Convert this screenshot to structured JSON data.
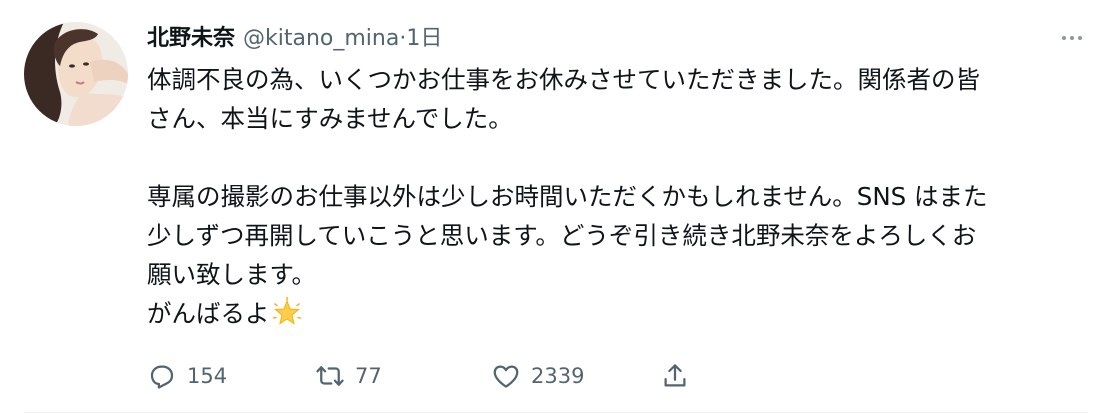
{
  "tweet": {
    "author": {
      "display_name": "北野未奈",
      "handle": "@kitano_mina",
      "separator": "·",
      "timestamp": "1日"
    },
    "body_lines": [
      "体調不良の為、いくつかお仕事をお休みさせていただきました。関係者の皆",
      "さん、本当にすみませんでした。",
      "",
      "専属の撮影のお仕事以外は少しお時間いただくかもしれません。SNS はまた",
      "少しずつ再開していこうと思います。どうぞ引き続き北野未奈をよろしくお",
      "願い致します。",
      "がんばるよ"
    ],
    "emoji": "glowing-star",
    "actions": {
      "replies": "154",
      "retweets": "77",
      "likes": "2339"
    },
    "icons": {
      "reply": "reply-icon",
      "retweet": "retweet-icon",
      "like": "heart-icon",
      "share": "share-icon",
      "more": "more-icon"
    },
    "colors": {
      "text": "#0f1419",
      "secondary": "#536471",
      "star": "#ffcc4d"
    }
  }
}
